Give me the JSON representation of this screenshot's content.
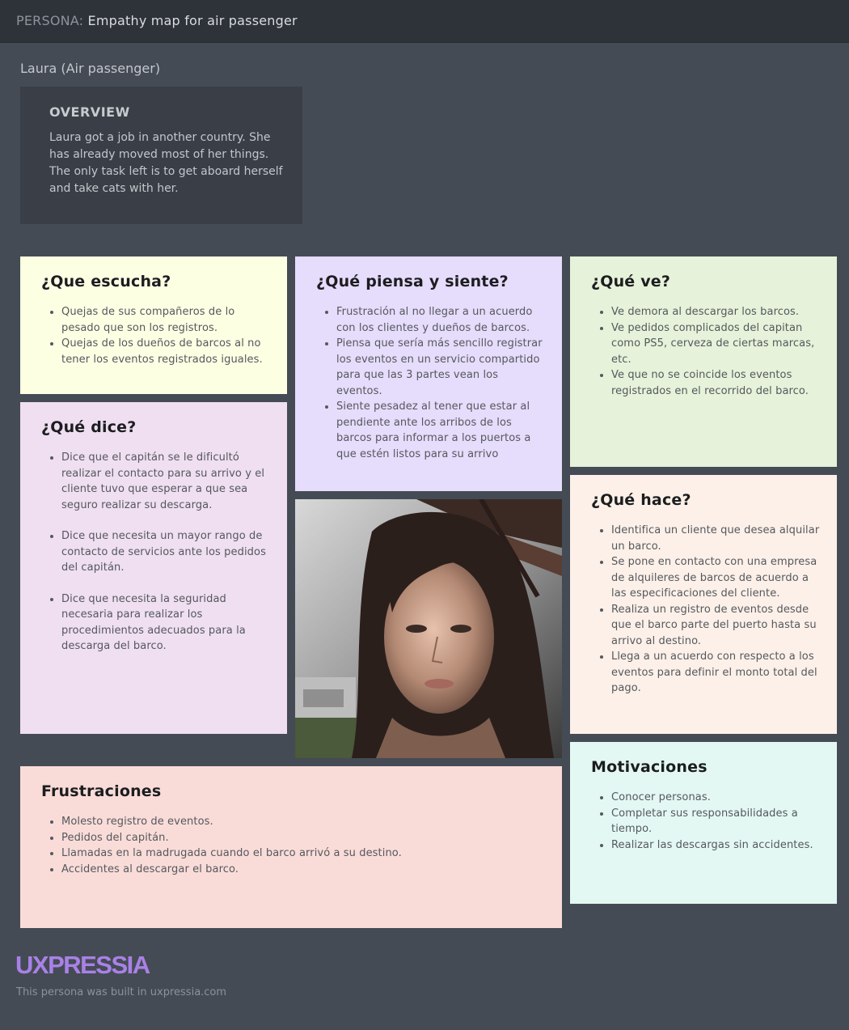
{
  "header": {
    "prefix": "PERSONA:",
    "title": "Empathy map for air passenger"
  },
  "persona": {
    "name": "Laura (Air passenger)"
  },
  "overview": {
    "heading": "OVERVIEW",
    "text": "Laura got a job in another country. She has already moved most of her things. The only task left is to get aboard herself and take cats with her."
  },
  "cards": {
    "escucha": {
      "title": "¿Que escucha?",
      "items": [
        "Quejas de sus compañeros de lo pesado que son los registros.",
        "Quejas de los dueños de barcos al no tener los eventos registrados iguales."
      ]
    },
    "piensa": {
      "title": "¿Qué piensa y siente?",
      "items": [
        "Frustración al no llegar a un acuerdo con los clientes y dueños de barcos.",
        "Piensa que sería más sencillo registrar los eventos en un servicio compartido para que las 3 partes vean los eventos.",
        "Siente pesadez al tener que estar al pendiente ante los arribos de los barcos para informar a los puertos a que estén listos para su arrivo"
      ]
    },
    "ve": {
      "title": "¿Qué ve?",
      "items": [
        "Ve demora al descargar los barcos.",
        "Ve pedidos complicados del capitan como PS5, cerveza de ciertas marcas, etc.",
        "Ve que no se coincide los eventos registrados en el recorrido del barco."
      ]
    },
    "dice": {
      "title": "¿Qué dice?",
      "items": [
        "Dice que el capitán se le dificultó realizar el contacto para su arrivo y el cliente tuvo que esperar a que sea seguro realizar su descarga.",
        "Dice que necesita un mayor rango de contacto de servicios ante los pedidos del capitán.",
        "Dice que necesita la seguridad necesaria para realizar los procedimientos adecuados para la descarga del barco."
      ]
    },
    "hace": {
      "title": "¿Qué hace?",
      "items": [
        "Identifica un cliente que desea alquilar un barco.",
        "Se pone en contacto con una empresa de alquileres de barcos de acuerdo a las especificaciones del cliente.",
        "Realiza un registro de eventos desde que el barco parte del puerto hasta su arrivo al destino.",
        "Llega a un acuerdo con respecto a los eventos para definir el monto total del pago."
      ]
    },
    "frustraciones": {
      "title": "Frustraciones",
      "items": [
        "Molesto registro de eventos.",
        "Pedidos del capitán.",
        "Llamadas en la madrugada cuando el barco arrivó a su destino.",
        "Accidentes al descargar el barco."
      ]
    },
    "motivaciones": {
      "title": "Motivaciones",
      "items": [
        "Conocer personas.",
        "Completar sus responsabilidades a tiempo.",
        "Realizar las descargas sin accidentes."
      ]
    }
  },
  "footer": {
    "brand": "UXPRESSIA",
    "note": "This persona was built in uxpressia.com"
  },
  "colors": {
    "background": "#454b55",
    "topbar": "#2e3239",
    "escucha": "#fdffe3",
    "piensa": "#e6dcfb",
    "ve": "#e6f2d9",
    "dice": "#efdff0",
    "hace": "#fcf0e8",
    "frustraciones": "#f9dcd8",
    "motivaciones": "#e3f8f3",
    "brand": "#a981e6"
  }
}
